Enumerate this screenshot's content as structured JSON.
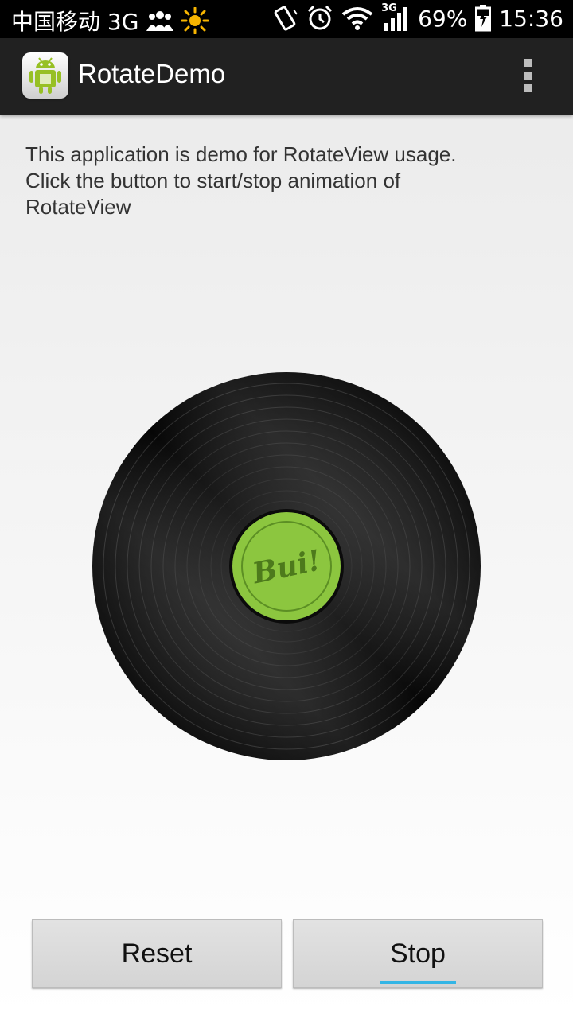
{
  "status_bar": {
    "carrier": "中国移动 3G",
    "network_type_small": "3G",
    "battery": "69%",
    "time": "15:36",
    "icons": [
      "people-icon",
      "sun-icon",
      "rotation-icon",
      "alarm-icon",
      "wifi-icon",
      "signal-icon",
      "battery-charging-icon"
    ]
  },
  "action_bar": {
    "title": "RotateDemo",
    "app_icon": "android-app-icon",
    "overflow_icon": "overflow-menu-icon"
  },
  "main": {
    "description": "This application is demo for RotateView usage.\nClick the button to start/stop animation of\nRotateView",
    "record": {
      "label_text": "Bui!",
      "label_color": "#8cc63f",
      "vinyl_color": "#111111"
    }
  },
  "buttons": {
    "reset_label": "Reset",
    "stop_label": "Stop",
    "focus_color": "#33b5e5"
  }
}
